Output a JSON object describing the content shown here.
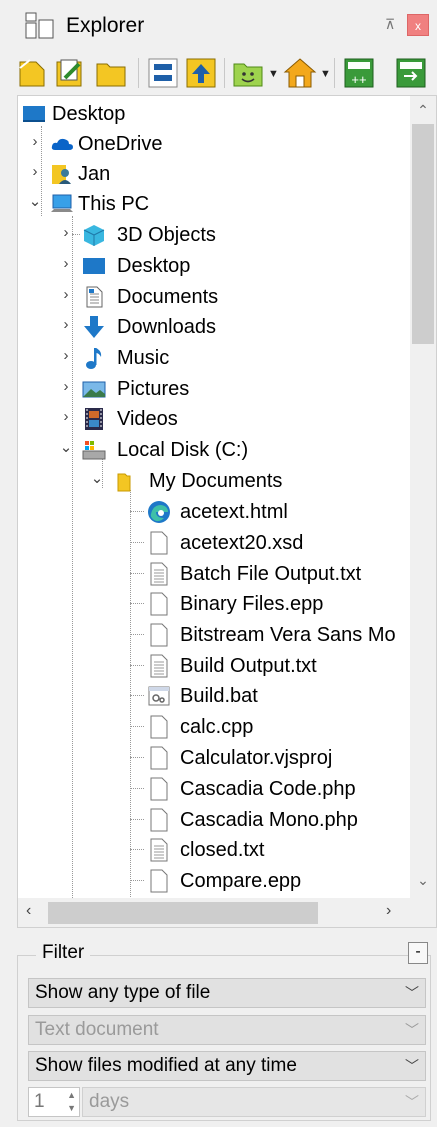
{
  "window": {
    "title": "Explorer",
    "pin_glyph": "⊼",
    "close_glyph": "x"
  },
  "toolbar": {
    "buttons": [
      "new-file-icon",
      "edit-file-icon",
      "folder-icon",
      "split-view-icon",
      "up-folder-icon",
      "favorites-icon",
      "home-icon",
      "new-project-icon",
      "open-project-icon"
    ]
  },
  "tree": {
    "items": [
      {
        "label": "Desktop"
      },
      {
        "label": "OneDrive"
      },
      {
        "label": "Jan"
      },
      {
        "label": "This PC"
      },
      {
        "label": "3D Objects"
      },
      {
        "label": "Desktop"
      },
      {
        "label": "Documents"
      },
      {
        "label": "Downloads"
      },
      {
        "label": "Music"
      },
      {
        "label": "Pictures"
      },
      {
        "label": "Videos"
      },
      {
        "label": "Local Disk (C:)"
      },
      {
        "label": "My Documents"
      },
      {
        "label": "acetext.html"
      },
      {
        "label": "acetext20.xsd"
      },
      {
        "label": "Batch File Output.txt"
      },
      {
        "label": "Binary Files.epp"
      },
      {
        "label": "Bitstream Vera Sans Mo"
      },
      {
        "label": "Build Output.txt"
      },
      {
        "label": "Build.bat"
      },
      {
        "label": "calc.cpp"
      },
      {
        "label": "Calculator.vjsproj"
      },
      {
        "label": "Cascadia Code.php"
      },
      {
        "label": "Cascadia Mono.php"
      },
      {
        "label": "closed.txt"
      },
      {
        "label": "Compare.epp"
      }
    ]
  },
  "filter": {
    "legend": "Filter",
    "collapse_label": "-",
    "type_select": "Show any type of file",
    "subtype_select": "Text document",
    "modified_select": "Show files modified at any time",
    "days_value": "1",
    "days_unit": "days"
  },
  "colors": {
    "accent": "#1e78c8",
    "folder": "#f3c623",
    "toolbar_green": "#7cc242"
  }
}
